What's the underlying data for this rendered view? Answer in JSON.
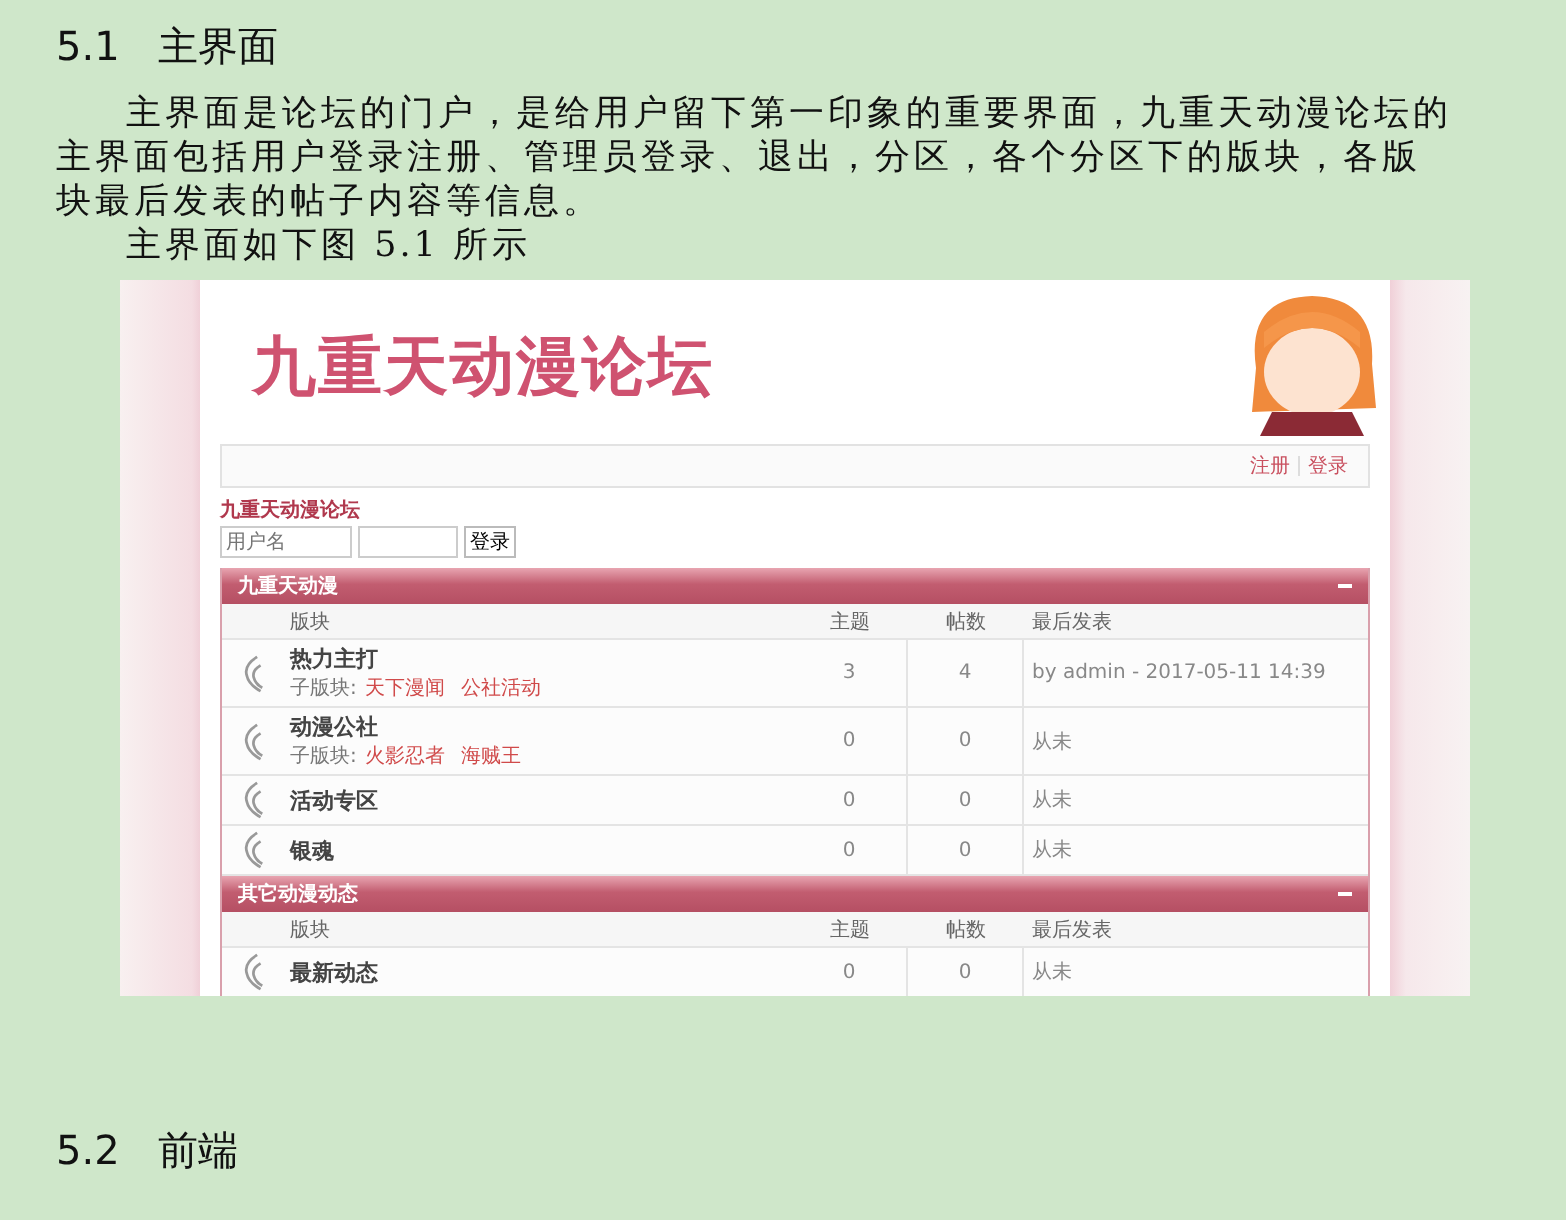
{
  "heading": {
    "number": "5.1",
    "title": "主界面"
  },
  "paragraphs": [
    "主界面是论坛的门户，是给用户留下第一印象的重要界面，九重天动漫论坛的主界面包括用户登录注册、管理员登录、退出，分区，各个分区下的版块，各版块最后发表的帖子内容等信息。",
    "主界面如下图 5.1 所示"
  ],
  "figure": {
    "logo": "九重天动漫论坛",
    "nav_links": [
      "注册",
      "登录"
    ],
    "breadcrumb": "九重天动漫论坛",
    "login": {
      "username_placeholder": "用户名",
      "button": "登录"
    },
    "sections": [
      {
        "title": "九重天动漫",
        "columns": [
          "版块",
          "主题",
          "帖数",
          "最后发表"
        ],
        "rows": [
          {
            "name": "热力主打",
            "subforum_label": "子版块:",
            "subforums": [
              "天下漫闻",
              "公社活动"
            ],
            "topics": "3",
            "posts": "4",
            "last_post": "by admin - 2017-05-11 14:39"
          },
          {
            "name": "动漫公社",
            "subforum_label": "子版块:",
            "subforums": [
              "火影忍者",
              "海贼王"
            ],
            "topics": "0",
            "posts": "0",
            "last_post": "从未"
          },
          {
            "name": "活动专区",
            "topics": "0",
            "posts": "0",
            "last_post": "从未"
          },
          {
            "name": "银魂",
            "topics": "0",
            "posts": "0",
            "last_post": "从未"
          }
        ]
      },
      {
        "title": "其它动漫动态",
        "columns": [
          "版块",
          "主题",
          "帖数",
          "最后发表"
        ],
        "rows": [
          {
            "name": "最新动态",
            "topics": "0",
            "posts": "0",
            "last_post": "从未"
          }
        ]
      }
    ]
  },
  "next_heading": {
    "number": "5.2",
    "title": "前端"
  }
}
